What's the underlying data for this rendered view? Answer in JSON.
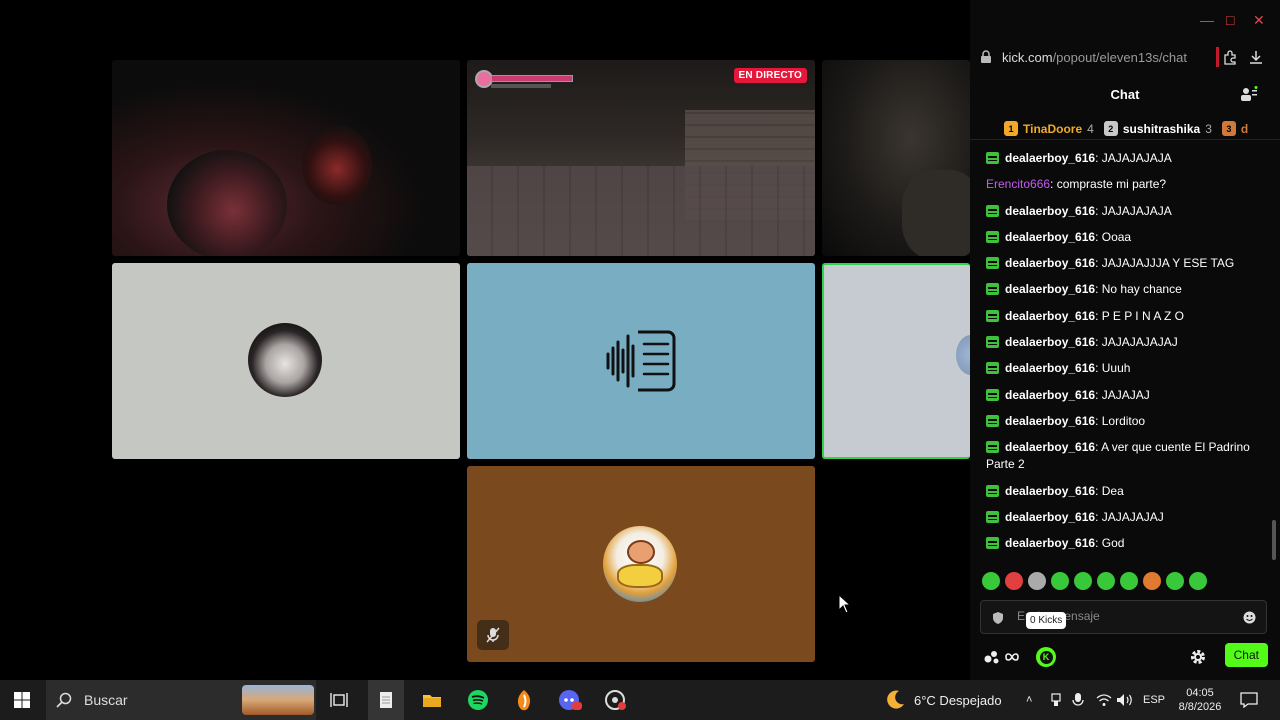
{
  "stage": {
    "live_badge": "EN DIRECTO"
  },
  "browser": {
    "url_host": "kick.com",
    "url_path": "/popout/eleven13s/chat"
  },
  "chat": {
    "title": "Chat",
    "top_gifters": [
      {
        "rank": "1",
        "name": "TinaDoore",
        "count": "4",
        "color": "#f0a92a"
      },
      {
        "rank": "2",
        "name": "sushitrashika",
        "count": "3",
        "color": "#c9c9c9"
      },
      {
        "rank": "3",
        "name": "d",
        "count": "",
        "color": "#cf7a3a"
      }
    ],
    "messages": [
      {
        "user": "dealaerboy_616",
        "text": ": JAJAJAJAJA"
      },
      {
        "user": "Erencito666",
        "text": ": compraste mi parte?"
      },
      {
        "user": "dealaerboy_616",
        "text": ": JAJAJAJAJA"
      },
      {
        "user": "dealaerboy_616",
        "text": ": Ooaa"
      },
      {
        "user": "dealaerboy_616",
        "text": ": JAJAJAJJJA Y ESE TAG"
      },
      {
        "user": "dealaerboy_616",
        "text": ": No hay chance"
      },
      {
        "user": "dealaerboy_616",
        "text": ": P E P I N A Z O"
      },
      {
        "user": "dealaerboy_616",
        "text": ": JAJAJAJAJAJ"
      },
      {
        "user": "dealaerboy_616",
        "text": ": Uuuh"
      },
      {
        "user": "dealaerboy_616",
        "text": ": JAJAJAJ"
      },
      {
        "user": "dealaerboy_616",
        "text": ": Lorditoo"
      },
      {
        "user": "dealaerboy_616",
        "text": ": A ver que cuente El Padrino Parte 2"
      },
      {
        "user": "dealaerboy_616",
        "text": ": Dea"
      },
      {
        "user": "dealaerboy_616",
        "text": ": JAJAJAJAJ"
      },
      {
        "user": "dealaerboy_616",
        "text": ": God"
      }
    ],
    "input_placeholder": "Enviar mensaje",
    "kicks_tooltip": "0 Kicks",
    "send_label": "Chat",
    "accent": "#53fc18"
  },
  "taskbar": {
    "search_label": "Buscar",
    "weather": "6°C Despejado",
    "language": "ESP",
    "time": "04:05",
    "date": "8/8/2026"
  }
}
